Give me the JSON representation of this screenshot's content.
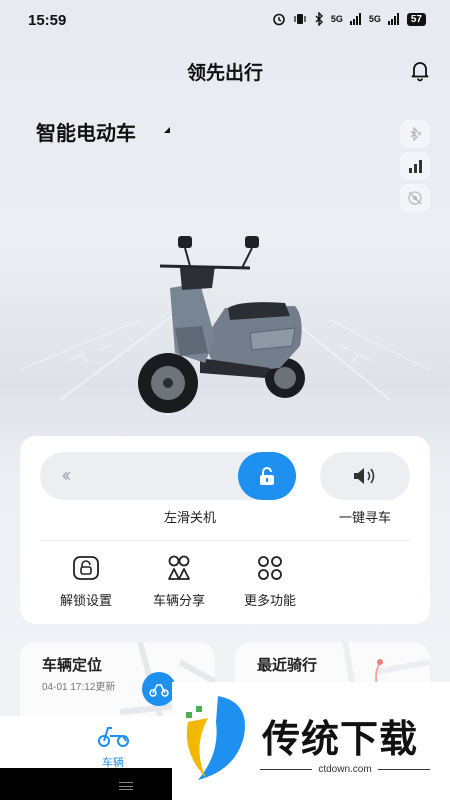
{
  "status_bar": {
    "time": "15:59",
    "signal_1": "5G",
    "signal_2": "5G",
    "battery": "57"
  },
  "header": {
    "title": "领先出行",
    "bell_icon": "bell-icon"
  },
  "vehicle": {
    "name": "智能电动车",
    "side_icons": [
      "bluetooth-off-icon",
      "signal-bars-icon",
      "gps-off-icon"
    ]
  },
  "controls": {
    "slide_label": "左滑关机",
    "slide_arrows": "«",
    "find_label": "一键寻车",
    "functions": [
      {
        "label": "解锁设置",
        "icon": "unlock-settings-icon"
      },
      {
        "label": "车辆分享",
        "icon": "share-icon"
      },
      {
        "label": "更多功能",
        "icon": "more-functions-icon"
      }
    ]
  },
  "cards": {
    "location": {
      "title": "车辆定位",
      "updated": "04-01 17:12更新"
    },
    "recent_ride": {
      "title": "最近骑行"
    }
  },
  "bottom_nav": {
    "active_label": "车辆"
  },
  "watermark": {
    "text": "传统下载",
    "url": "ctdown.com"
  },
  "colors": {
    "accent": "#1e90f0",
    "card_bg": "#ffffff",
    "track_bg": "#eceef2"
  }
}
